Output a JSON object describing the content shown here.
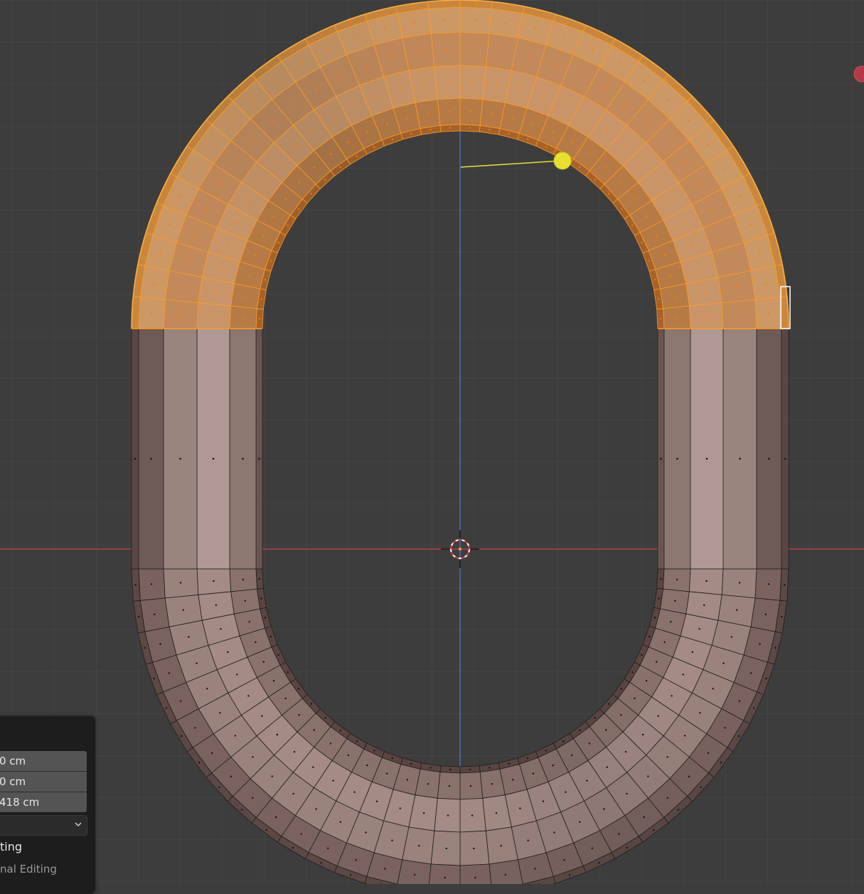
{
  "panel": {
    "field_1": "0 cm",
    "field_2": "0 cm",
    "field_3": "418 cm",
    "dropdown_value": "",
    "option_1": "ting",
    "option_2": "nal Editing"
  },
  "icons": {
    "dropdown": "chevron-down-icon",
    "cursor": "3d-cursor-icon",
    "light": "light-gizmo-icon",
    "indicator": "red-dot-icon"
  },
  "colors": {
    "background": "#3d3d3d",
    "grid": "#4a4a4a",
    "x_axis": "#c8414f",
    "y_axis": "#4a7fc4",
    "selection": "#ff9b1f",
    "mesh_light": "#a98f88",
    "mesh_dark": "#5e4a45"
  }
}
